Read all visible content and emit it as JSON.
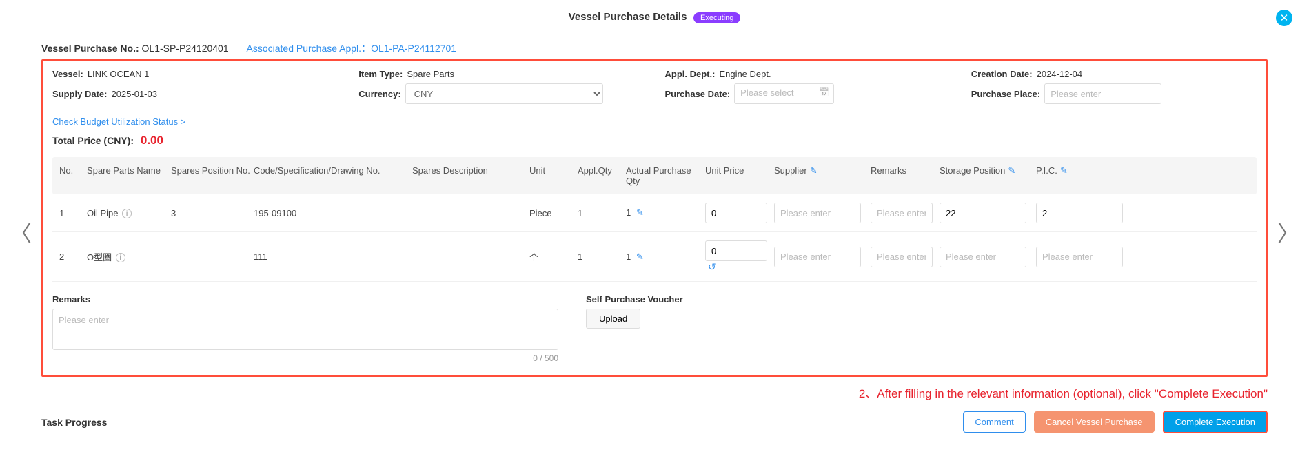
{
  "header": {
    "title": "Vessel Purchase Details",
    "status_badge": "Executing",
    "close_symbol": "✕"
  },
  "order": {
    "number_label": "Vessel Purchase No.:",
    "number": "OL1-SP-P24120401",
    "assoc_label": "Associated Purchase Appl.：",
    "assoc_value": "OL1-PA-P24112701"
  },
  "info": {
    "vessel_label": "Vessel:",
    "vessel": "LINK OCEAN 1",
    "item_type_label": "Item Type:",
    "item_type": "Spare Parts",
    "appl_dept_label": "Appl. Dept.:",
    "appl_dept": "Engine Dept.",
    "creation_date_label": "Creation Date:",
    "creation_date": "2024-12-04",
    "supply_date_label": "Supply Date:",
    "supply_date": "2025-01-03",
    "currency_label": "Currency:",
    "currency": "CNY",
    "purchase_date_label": "Purchase Date:",
    "purchase_date_placeholder": "Please select",
    "purchase_place_label": "Purchase Place:",
    "purchase_place_placeholder": "Please enter"
  },
  "budget_link": "Check Budget Utilization Status >",
  "total": {
    "label": "Total Price (CNY):",
    "value": "0.00"
  },
  "table": {
    "headers": {
      "no": "No.",
      "name": "Spare Parts Name",
      "pos": "Spares Position No.",
      "code": "Code/Specification/Drawing No.",
      "desc": "Spares Description",
      "unit": "Unit",
      "aqty": "Appl.Qty",
      "actqty": "Actual Purchase Qty",
      "price": "Unit Price",
      "supp": "Supplier",
      "rem": "Remarks",
      "stor": "Storage Position",
      "pic": "P.I.C."
    },
    "rows": [
      {
        "no": "1",
        "name": "Oil Pipe",
        "pos": "3",
        "code": "195-09100",
        "desc": "",
        "unit": "Piece",
        "aqty": "1",
        "actqty": "1",
        "price": "0",
        "supp": "",
        "rem": "",
        "stor": "22",
        "pic": "2",
        "showUndo": false
      },
      {
        "no": "2",
        "name": "O型圈",
        "pos": "",
        "code": "111",
        "desc": "",
        "unit": "个",
        "aqty": "1",
        "actqty": "1",
        "price": "0",
        "supp": "",
        "rem": "",
        "stor": "",
        "pic": "",
        "showUndo": true
      }
    ],
    "placeholder": "Please enter"
  },
  "lower": {
    "remarks_label": "Remarks",
    "remarks_placeholder": "Please enter",
    "remarks_count": "0 / 500",
    "voucher_label": "Self Purchase Voucher",
    "upload_btn": "Upload"
  },
  "nav": {
    "left": "〈",
    "right": "〉"
  },
  "instruction": "2、After filling in the relevant information (optional), click \"Complete Execution\"",
  "bottom": {
    "task": "Task Progress",
    "comment": "Comment",
    "cancel": "Cancel Vessel Purchase",
    "complete": "Complete Execution"
  }
}
